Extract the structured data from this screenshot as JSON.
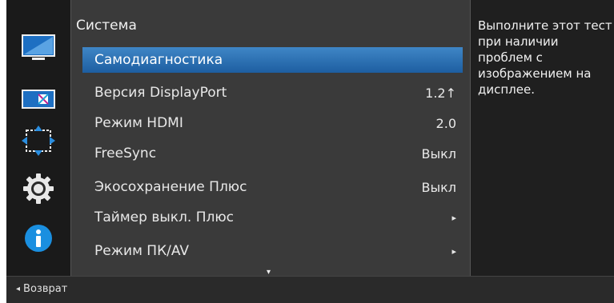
{
  "panel": {
    "title": "Система"
  },
  "menu": {
    "items": [
      {
        "label": "Самодиагностика",
        "value": "",
        "selected": true
      },
      {
        "label": "Версия DisplayPort",
        "value": "1.2↑"
      },
      {
        "label": "Режим HDMI",
        "value": "2.0"
      },
      {
        "label": "FreeSync",
        "value": "Выкл"
      },
      {
        "label": "Экосохранение Плюс",
        "value": "Выкл"
      },
      {
        "label": "Таймер выкл. Плюс",
        "value": "▸"
      },
      {
        "label": "Режим ПК/AV",
        "value": "▸"
      }
    ],
    "scroll_indicator": "▾"
  },
  "help": {
    "text": "Выполните этот тест при наличии проблем с изображением на дисплее."
  },
  "footer": {
    "back_arrow": "◂",
    "back_label": "Возврат"
  },
  "sidebar": {
    "icons": [
      "picture-icon",
      "color-icon",
      "size-position-icon",
      "system-gear-icon",
      "info-icon"
    ]
  },
  "colors": {
    "selection": "#2f75b5",
    "info_icon": "#1a8fe0",
    "background": "#1f1f1f",
    "panel": "#3a3a3a"
  }
}
